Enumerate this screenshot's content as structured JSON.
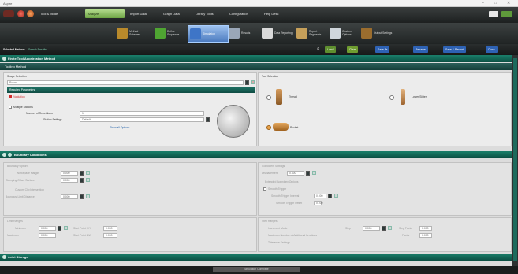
{
  "window": {
    "title": "Aspire",
    "controls": [
      "–",
      "□",
      "✕"
    ]
  },
  "menubar": {
    "items": [
      {
        "label": "Tool & Model",
        "active": false
      },
      {
        "label": "Analyze",
        "active": true
      },
      {
        "label": "Import Data",
        "active": false
      },
      {
        "label": "Graph Data",
        "active": false
      },
      {
        "label": "Library Tools",
        "active": false
      },
      {
        "label": "Configuration",
        "active": false
      },
      {
        "label": "Help Desk",
        "active": false
      }
    ]
  },
  "ribbon": {
    "items": [
      {
        "label": "Method Schemes",
        "color": "#b98a2b"
      },
      {
        "label": "Define Sequence",
        "color": "#4fa532"
      },
      {
        "label": "Simulation",
        "color": "#3e75c7",
        "active": true
      },
      {
        "label": "Results",
        "color": "#9aa7b8"
      },
      {
        "label": "Data Reporting",
        "color": "#d9d9d9"
      },
      {
        "label": "Report Segments",
        "color": "#c6a05a"
      },
      {
        "label": "Custom Options",
        "color": "#cfd6dc"
      },
      {
        "label": "Output Settings",
        "color": "#9b6d2e"
      }
    ]
  },
  "methodstrip": {
    "label": "Selected Method:",
    "value": "Search Results",
    "buttons": [
      {
        "label": "Load",
        "color": "#5f8f2f"
      },
      {
        "label": "Clear",
        "color": "#6f9d30"
      },
      {
        "label": "Save As",
        "color": "#2e62b4"
      },
      {
        "label": "Rename",
        "color": "#2e62b4"
      },
      {
        "label": "Save & Restart",
        "color": "#2e62b4"
      },
      {
        "label": "Close",
        "color": "#2e62b4"
      }
    ]
  },
  "sections": {
    "pane1": "Finite Tool Acceleration Method",
    "pane1_sub": "Tooling Method",
    "pane2": "Boundary Conditions",
    "pane3": "Joint Storage"
  },
  "tooling": {
    "shape_label": "Shape Selection",
    "shape_value": "Round",
    "param_header": "Required Parameters",
    "warning": "Validation",
    "multiple_label": "Multiple Stations",
    "num_label": "Number of Repetitions",
    "num_value": "1",
    "station_label": "Station Settings",
    "station_value": "Default",
    "link": "Show all Options",
    "tool_selection_label": "Tool Selection",
    "tools": [
      "Thread",
      "Lower Slitter",
      "Pocket"
    ]
  },
  "boundary": {
    "left_title": "Boundary Options",
    "rows": [
      "Workspace Margin",
      "Clamping Offset Surface",
      "Custom Clip Intersection",
      "Boundary Limit Distance"
    ],
    "row_value": "0.000",
    "right_title": "Coincident Settings",
    "right_row": "Displacement",
    "right_title2": "Extended Boundary Options",
    "right_chk": "Smooth Trigger",
    "right_rows": [
      "Smooth Trigger Interval",
      "Smooth Trigger Offset"
    ],
    "low_left_title": "Limit Ranges",
    "low_left_rows": [
      "Minimum",
      "Start Point X/Y",
      "Maximum",
      "Start Point Z/W"
    ],
    "low_right_title": "Step Ranges",
    "low_right_rows": [
      "Increment Mode",
      "Maximum Number of Additional Iterations",
      "Tolerance Settings"
    ],
    "low_right_side": [
      "Step",
      "Step Factor",
      "Factor"
    ]
  },
  "statusbar": {
    "text": "Simulation Complete"
  }
}
